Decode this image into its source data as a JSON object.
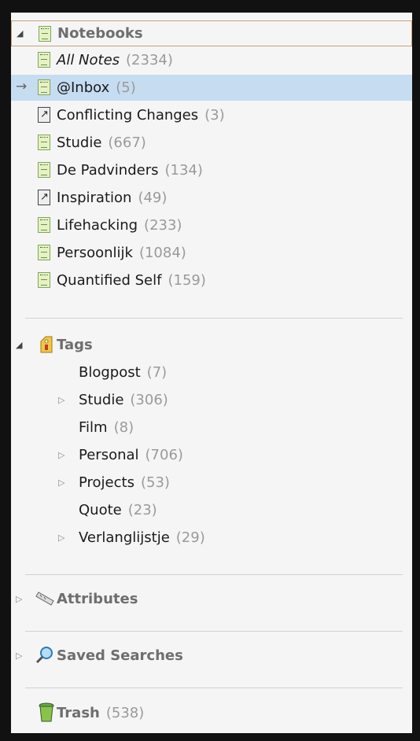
{
  "notebooks": {
    "header_label": "Notebooks",
    "items": [
      {
        "label": "All Notes",
        "count": "(2334)"
      },
      {
        "label": "@Inbox",
        "count": "(5)"
      },
      {
        "label": "Conflicting Changes",
        "count": "(3)"
      },
      {
        "label": "Studie",
        "count": "(667)"
      },
      {
        "label": "De Padvinders",
        "count": "(134)"
      },
      {
        "label": "Inspiration",
        "count": "(49)"
      },
      {
        "label": "Lifehacking",
        "count": "(233)"
      },
      {
        "label": "Persoonlijk",
        "count": "(1084)"
      },
      {
        "label": "Quantified Self",
        "count": "(159)"
      }
    ]
  },
  "tags": {
    "header_label": "Tags",
    "items": [
      {
        "label": "Blogpost",
        "count": "(7)"
      },
      {
        "label": "Studie",
        "count": "(306)"
      },
      {
        "label": "Film",
        "count": "(8)"
      },
      {
        "label": "Personal",
        "count": "(706)"
      },
      {
        "label": "Projects",
        "count": "(53)"
      },
      {
        "label": "Quote",
        "count": "(23)"
      },
      {
        "label": "Verlanglijstje",
        "count": "(29)"
      }
    ]
  },
  "attributes": {
    "label": "Attributes"
  },
  "saved_searches": {
    "label": "Saved Searches"
  },
  "trash": {
    "label": "Trash",
    "count": "(538)"
  },
  "colors": {
    "selection": "#c6dcf1",
    "count": "#9a9a9a",
    "section_title": "#6e6e6e"
  },
  "icons": {
    "notebook": "notebook-icon",
    "conflict_notebook": "linked-notebook-icon",
    "tags": "tags-icon",
    "attributes": "ruler-icon",
    "saved_searches": "magnifier-icon",
    "trash": "trash-can-icon",
    "current": "arrow-right-icon"
  }
}
